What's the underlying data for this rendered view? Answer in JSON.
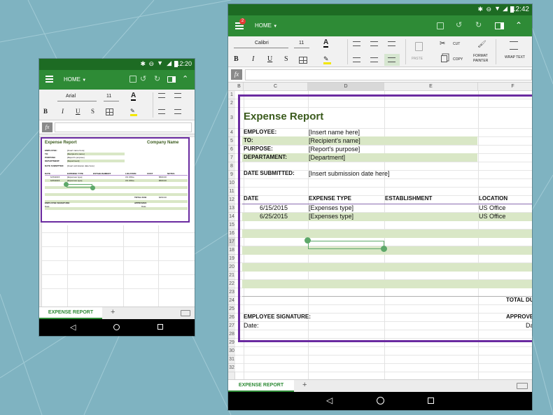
{
  "phone_small": {
    "status": {
      "time": "12:20"
    },
    "appbar": {
      "home_label": "HOME"
    },
    "ribbon": {
      "font_name": "Arial",
      "font_size": "11",
      "bold": "B",
      "italic": "I",
      "underline": "U",
      "strike": "S"
    },
    "formula": {
      "fx_label": "fx"
    },
    "sheet": {
      "title": "Expense Report",
      "company": "Company Name",
      "employee_label": "EMPLOYEE:",
      "employee_value": "[Insert name here]",
      "to_label": "TO:",
      "to_value": "[Recipient's name]",
      "purpose_label": "PURPOSE:",
      "purpose_value": "[Report's purpose]",
      "department_label": "DEPARTMENT:",
      "department_value": "[Department]",
      "date_submitted_label": "DATE SUBMITTED:",
      "date_submitted_value": "[Insert submission date here]",
      "headers": [
        "DATE",
        "EXPENSE TYPE",
        "ESTABLISHMENT",
        "LOCATION",
        "COST",
        "NOTES"
      ],
      "rows": [
        {
          "date": "6/15/2015",
          "type": "[Expenses type]",
          "location": "US Office",
          "cost": "$500.00"
        },
        {
          "date": "6/25/2015",
          "type": "[Expenses type]",
          "location": "US Office",
          "cost": "$500.00"
        }
      ],
      "total_label": "TOTAL DUE:",
      "total_value": "$450.00",
      "employee_signature": "EMPLOYEE SIGNATURE:",
      "approved": "APPROVED:",
      "date_label": "Date:",
      "date_label2": "Date:"
    },
    "tab": {
      "name": "EXPENSE REPORT",
      "add": "+"
    }
  },
  "phone_large": {
    "status": {
      "time": "12:42"
    },
    "appbar": {
      "home_label": "HOME",
      "badge": "2"
    },
    "ribbon": {
      "font_name": "Calibri",
      "font_size": "11",
      "bold": "B",
      "italic": "I",
      "underline": "U",
      "strike": "S",
      "paste": "PASTE",
      "cut": "CUT",
      "copy": "COPY",
      "format_painter_line1": "FORMAT",
      "format_painter_line2": "PAINTER",
      "wrap_text": "WRAP TEXT"
    },
    "formula": {
      "fx_label": "fx"
    },
    "columns": [
      "B",
      "C",
      "D",
      "E",
      "F"
    ],
    "rows": [
      "1",
      "2",
      "3",
      "4",
      "5",
      "6",
      "7",
      "8",
      "9",
      "10",
      "11",
      "12",
      "13",
      "14",
      "15",
      "16",
      "17",
      "18",
      "19",
      "20",
      "21",
      "22",
      "23",
      "24",
      "25",
      "26",
      "27",
      "28",
      "29",
      "30",
      "31",
      "32"
    ],
    "sheet": {
      "title": "Expense Report",
      "employee_label": "EMPLOYEE:",
      "employee_value": "[Insert name here]",
      "to_label": "TO:",
      "to_value": "[Recipient's name]",
      "purpose_label": "PURPOSE:",
      "purpose_value": "[Report's purpose]",
      "department_label": "DEPARTAMENT:",
      "department_value": "[Department]",
      "date_submitted_label": "DATE SUBMITTED:",
      "date_submitted_value": "[Insert submission date here]",
      "headers": [
        "DATE",
        "EXPENSE TYPE",
        "ESTABLISHMENT",
        "LOCATION"
      ],
      "rows": [
        {
          "date": "6/15/2015",
          "type": "[Expenses type]",
          "location": "US Office"
        },
        {
          "date": "6/25/2015",
          "type": "[Expenses type]",
          "location": "US Office"
        }
      ],
      "total_label": "TOTAL DU",
      "employee_signature": "EMPLOYEE SIGNATURE:",
      "approved": "APPROVE",
      "date_label": "Date:",
      "date_label2": "Da"
    },
    "tab": {
      "name": "EXPENSE REPORT",
      "add": "+"
    }
  },
  "colors": {
    "brand_green": "#2e8b36",
    "status_green": "#1d6b23",
    "band_green": "#d9e7c6",
    "selection_purple": "#6a2aa0",
    "title_green": "#3a5a1c"
  }
}
